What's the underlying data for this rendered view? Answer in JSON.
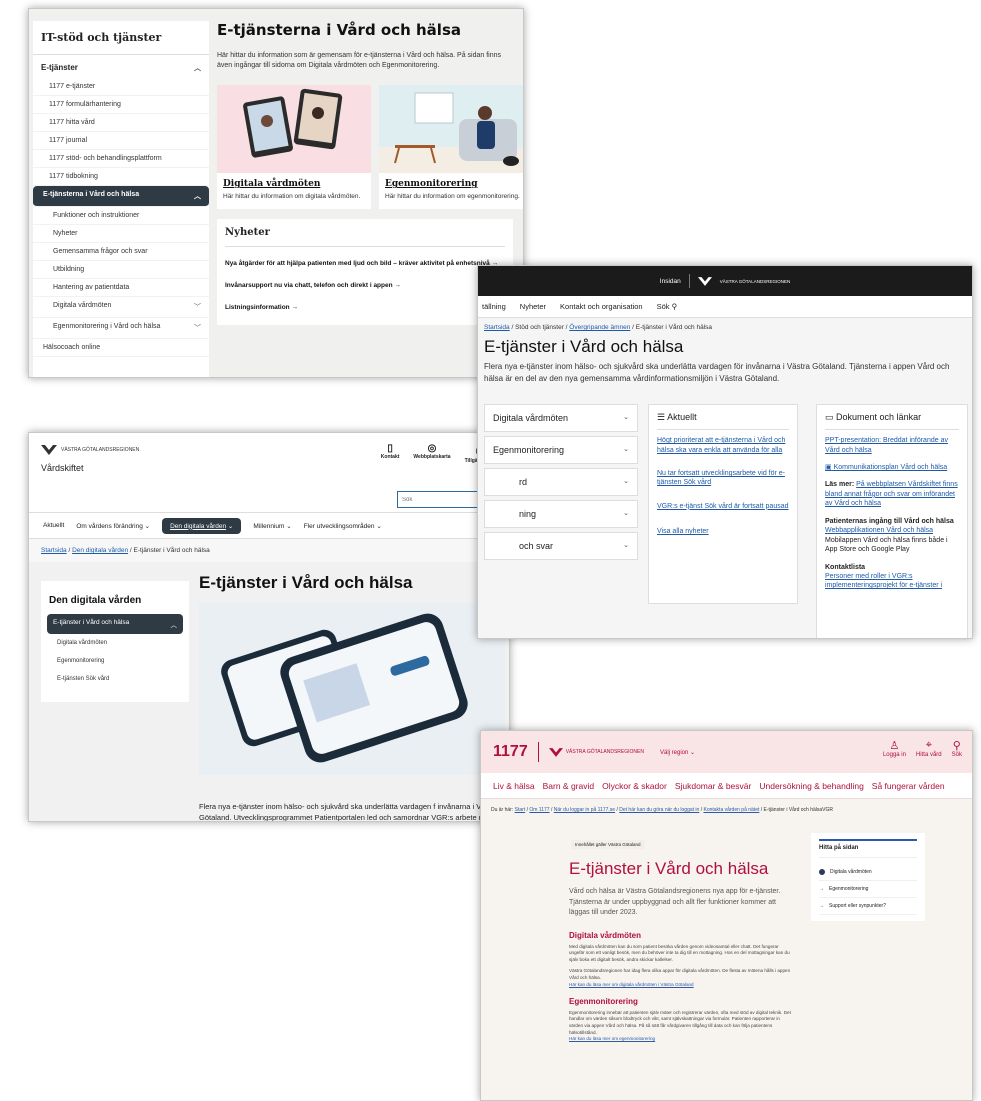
{
  "s1": {
    "sidebar_title": "IT-stöd och tjänster",
    "group_label": "E-tjänster",
    "items": [
      "1177 e-tjänster",
      "1177 formulärhantering",
      "1177 hitta vård",
      "1177 journal",
      "1177 stöd- och behandlingsplattform",
      "1177 tidbokning"
    ],
    "active": "E-tjänsterna i Vård och hälsa",
    "subitems": [
      "Funktioner och instruktioner",
      "Nyheter",
      "Gemensamma frågor och svar",
      "Utbildning",
      "Hantering av patientdata",
      "Digitala vårdmöten",
      "Egenmonitorering i Vård och hälsa"
    ],
    "bottom_item": "Hälsocoach online",
    "title": "E-tjänsterna i Vård och hälsa",
    "intro": "Här hittar du information som är gemensam för e-tjänsterna i Vård och hälsa. På sidan finns även ingångar till sidorna om Digitala vårdmöten och Egenmonitorering.",
    "cards": [
      {
        "title": "Digitala vårdmöten",
        "desc": "Här hittar du information om digitala vårdmöten."
      },
      {
        "title": "Egenmonitorering",
        "desc": "Här hittar du information om egenmonitorering."
      }
    ],
    "news_title": "Nyheter",
    "news": [
      "Nya åtgärder för att hjälpa patienten med ljud och bild – kräver aktivitet på enhetsnivå →",
      "Invånarsupport nu via chatt, telefon och direkt i appen →",
      "Listningsinformation →"
    ]
  },
  "s2": {
    "site": "Insidan",
    "org": "VÄSTRA GÖTALANDSREGIONEN",
    "nav": [
      "tällning",
      "Nyheter",
      "Kontakt och organisation",
      "Sök"
    ],
    "crumb": [
      "Startsida",
      "Stöd och tjänster",
      "Övergripande ämnen",
      "E-tjänster i Vård och hälsa"
    ],
    "title": "E-tjänster i Vård och hälsa",
    "intro": "Flera nya e-tjänster inom hälso- och sjukvård ska underlätta vardagen för invånarna i Västra Götaland. Tjänsterna i appen Vård och hälsa är en del av den nya gemensamma vårdinformationsmiljön i Västra Götaland.",
    "accordion": [
      "Digitala vårdmöten",
      "Egenmonitorering",
      "rd",
      "ning",
      "och svar"
    ],
    "aktuellt_title": "Aktuellt",
    "aktuellt": [
      "Högt prioriterat att e-tjänsterna i Vård och hälsa ska vara enkla att använda för alla",
      "Nu tar fortsatt utvecklingsarbete vid för e-tjänsten Sök vård",
      "VGR:s e-tjänst Sök vård är fortsatt pausad",
      "Visa alla nyheter"
    ],
    "docs_title": "Dokument och länkar",
    "docs_link1": "PPT-presentation: Breddat införande av Vård och hälsa",
    "docs_link2": "Kommunikationsplan Vård och hälsa",
    "las_mer_label": "Läs mer:",
    "las_mer": "På webbplatsen Vårdskiftet finns bland annat frågor och svar om införandet av Vård och hälsa",
    "pat_title": "Patienternas ingång till Vård och hälsa",
    "pat_link": "Webbapplikationen Vård och hälsa",
    "pat_text": "Mobilappen Vård och hälsa finns både i App Store och Google Play",
    "kontakt_title": "Kontaktlista",
    "kontakt_link": "Personer med roller i VGR:s implementeringsprojekt för e-tjänster i"
  },
  "s3": {
    "org": "VÄSTRA GÖTALANDSREGIONEN",
    "site": "Vårdskiftet",
    "tools": [
      "Kontakt",
      "Webbplatskarta",
      "Tillgänglighet"
    ],
    "search_placeholder": "Sök",
    "nav": [
      "Aktuellt",
      "Om vårdens förändring",
      "Den digitala vården",
      "Millennium",
      "Fler utvecklingsområden"
    ],
    "crumb": [
      "Startsida",
      "Den digitala vården",
      "E-tjänster i Vård och hälsa"
    ],
    "side_title": "Den digitala vården",
    "side_active": "E-tjänster i Vård och hälsa",
    "side_items": [
      "Digitala vårdmöten",
      "Egenmonitorering",
      "E-tjänsten Sök vård"
    ],
    "title": "E-tjänster i Vård och hälsa",
    "body": "Flera nya e-tjänster inom hälso- och sjukvård ska underlätta vardagen f invånarna i Västra Götaland. Utvecklingsprogrammet Patientportalen led och samordnar VGR:s arbete med att införa de e-tjänster för invånare s"
  },
  "s4": {
    "brand": "1177",
    "org": "VÄSTRA GÖTALANDSREGIONEN",
    "region": "Välj region",
    "tools": [
      "Logga in",
      "Hitta vård",
      "Sök"
    ],
    "nav": [
      "Liv & hälsa",
      "Barn & gravid",
      "Olyckor & skador",
      "Sjukdomar & besvär",
      "Undersökning & behandling",
      "Så fungerar vården"
    ],
    "crumb_label": "Du är här:",
    "crumb": [
      "Start",
      "Om 1177",
      "När du loggar in på 1177.se",
      "Det här kan du göra när du loggat in",
      "Kontakta vården på nätet",
      "E-tjänster i Vård och hälsaVGR"
    ],
    "tag": "Innehållet gäller Västra Götaland",
    "title": "E-tjänster i Vård och hälsa",
    "lead": "Vård och hälsa är Västra Götalandsregionens nya app för e-tjänster. Tjänsterna är under uppbyggnad och allt fler funktioner kommer att läggas till under 2023.",
    "sec1_title": "Digitala vårdmöten",
    "sec1_body": "Med digitala vårdmöten kan du som patient besöka vården genom videosamtal eller chatt. Det fungerar ungefär som ett vanligt besök, men du behöver inte ta dig till en mottagning. Hos en del mottagningar kan du själv boka ett digitalt besök, andra skickar kallelser.",
    "sec1_body2": "Västra Götalandsregionen har idag flera olika appar för digitala vårdmöten. De flesta av mötena hålls i appen Vård och hälsa.",
    "sec1_link": "Här kan du läsa mer om digitala vårdmöten i Västra Götaland",
    "sec2_title": "Egenmonitorering",
    "sec2_body": "Egenmonitorering innebär att patienten själv mäter och registrerar värden, ofta med stöd av digital teknik. Det handlar om värden såsom blodtryck och vikt, samt självskattningar via formulär. Patienten rapporterar in värden via appen Vård och hälsa. På så sätt får vårdgivaren tillgång till data och kan följa patientens hälsotillstånd.",
    "sec2_link": "Här kan du läsa mer om egenmonitorering",
    "toc_title": "Hitta på sidan",
    "toc": [
      "Digitala vårdmöten",
      "Egenmonitorering",
      "Support eller synpunkter?"
    ]
  },
  "colors": {
    "dark_nav": "#2f3b44",
    "link": "#1e5aa8",
    "brand_1177": "#b0103a"
  }
}
